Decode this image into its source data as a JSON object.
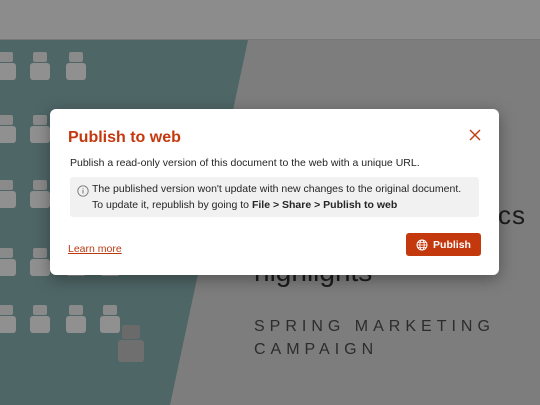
{
  "background": {
    "text_line_1": "cs",
    "text_line_2": "highlights",
    "subtitle_line_1": "SPRING MARKETING",
    "subtitle_line_2": "CAMPAIGN"
  },
  "dialog": {
    "title": "Publish to web",
    "description": "Publish a read-only version of this document to the web with a unique URL.",
    "info": {
      "line1": "The published version won't update with new changes to the original document.",
      "line2_prefix": "To update it, republish by going to ",
      "path_file": "File",
      "sep1": " > ",
      "path_share": "Share",
      "sep2": " > ",
      "path_publish": "Publish to web"
    },
    "learn_more": "Learn more",
    "publish_label": "Publish",
    "close_icon": "close-icon",
    "publish_icon": "globe-icon",
    "info_icon": "info-icon"
  },
  "colors": {
    "accent": "#c4380e",
    "link": "#b83a12",
    "overlay": "#7c7c7c"
  }
}
